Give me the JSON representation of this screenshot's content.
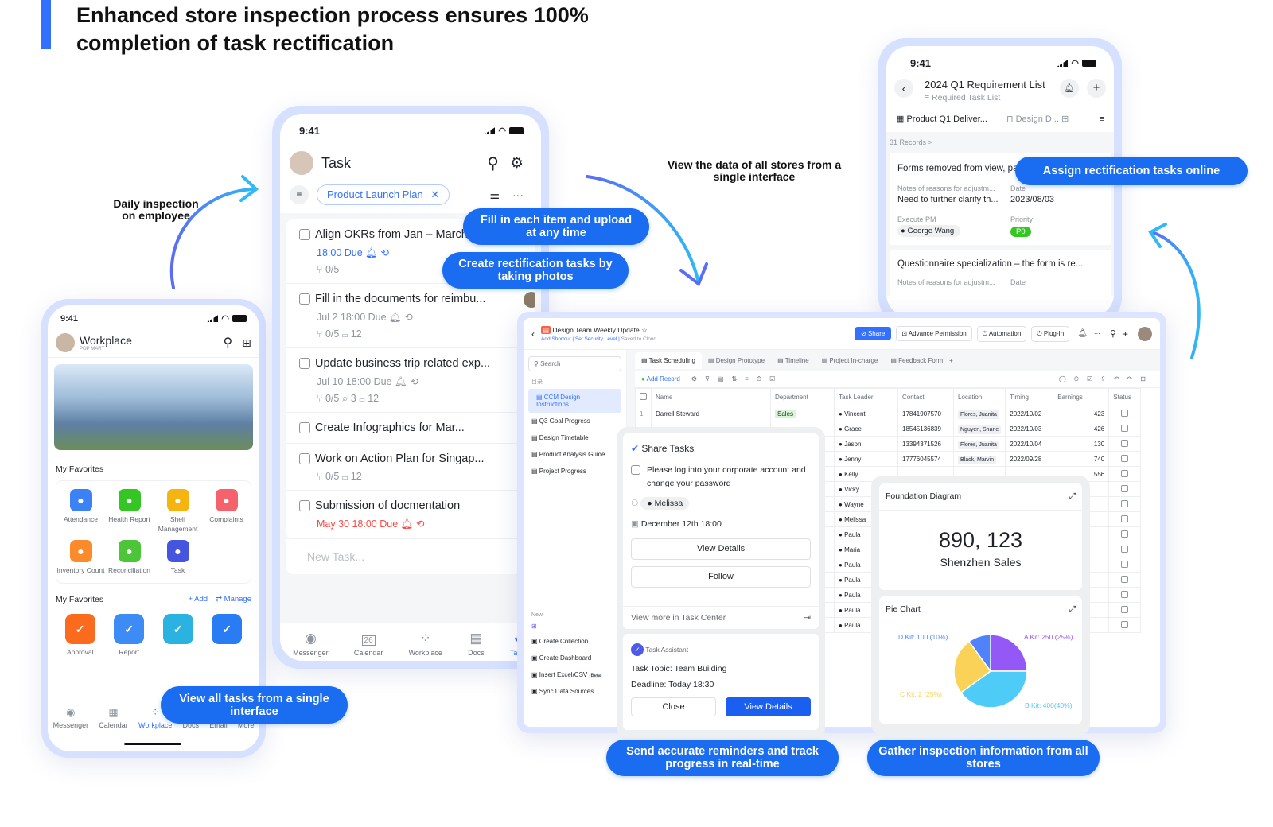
{
  "headline": {
    "line1": "Enhanced store inspection process ensures 100%",
    "line2": "completion of task rectification"
  },
  "notes": {
    "daily": "Daily inspection on employee",
    "view_data": "View the data of all stores from a single interface"
  },
  "callouts": {
    "fill": "Fill in each item and upload at any time",
    "create": "Create rectification tasks by taking photos",
    "assign": "Assign rectification tasks online",
    "view_all": "View all tasks from a single interface",
    "send": "Send accurate reminders and track progress in real-time",
    "gather": "Gather inspection information from all stores"
  },
  "colors": {
    "accent": "#1a6cf0",
    "frame": "#d6e0ff",
    "brand_blue": "#3370ff"
  },
  "workplace_phone": {
    "time": "9:41",
    "title": "Workplace",
    "subtitle": "POP MART",
    "favorites_title": "My Favorites",
    "favorites": [
      {
        "label": "Attendance",
        "icon": "location-pin-icon",
        "color": "#3b82f6"
      },
      {
        "label": "Health Report",
        "icon": "shield-plus-icon",
        "color": "#34c724"
      },
      {
        "label": "Shelf Management",
        "icon": "box-icon",
        "color": "#f5b40f"
      },
      {
        "label": "Complaints",
        "icon": "warning-icon",
        "color": "#f5626b"
      },
      {
        "label": "Inventory Count",
        "icon": "boxes-icon",
        "color": "#fb8a2b"
      },
      {
        "label": "Reconciliation",
        "icon": "yen-icon",
        "color": "#4cc538"
      },
      {
        "label": "Task",
        "icon": "check-icon",
        "color": "#4655e0"
      }
    ],
    "favorites2_title": "My Favorites",
    "add": "+ Add",
    "manage": "⇄ Manage",
    "apps2": [
      {
        "label": "Approval",
        "color": "#fb6b1e"
      },
      {
        "label": "Report",
        "color": "#3d8bf5"
      },
      {
        "label": "",
        "color": "#2ab3e0"
      },
      {
        "label": "",
        "color": "#2a7cf5"
      }
    ],
    "tabs": [
      "Messenger",
      "Calendar",
      "Workplace",
      "Docs",
      "Email",
      "More"
    ]
  },
  "task_phone": {
    "time": "9:41",
    "title": "Task",
    "filter": "Product Launch Plan",
    "tasks": [
      {
        "title": "Align OKRs from Jan – March, a...",
        "due": "18:00 Due",
        "extra": "⑂ 0/5",
        "due_color": "#3370ff"
      },
      {
        "title": "Fill in the documents for reimbu...",
        "due": "Jul 2 18:00 Due",
        "extra": "⑂ 0/5  ▭ 12",
        "due_color": "#8f959e"
      },
      {
        "title": "Update business trip related exp...",
        "due": "Jul 10 18:00 Due",
        "extra": "⑂ 0/5  ⌀ 3  ▭ 12",
        "due_color": "#8f959e"
      },
      {
        "title": "Create Infographics for Mar...",
        "due": "",
        "extra": "",
        "badge": "+5"
      },
      {
        "title": "Work on Action Plan for Singap...",
        "due": "",
        "extra": "⑂ 0/5  ▭ 12"
      },
      {
        "title": "Submission of docmentation",
        "due": "May 30 18:00 Due",
        "extra": "",
        "due_color": "#f54a45"
      }
    ],
    "new_task": "New Task...",
    "tabs": [
      "Messenger",
      "Calendar",
      "Workplace",
      "Docs",
      "Tasks"
    ],
    "calendar_day": "26"
  },
  "req_phone": {
    "time": "9:41",
    "title": "2024 Q1 Requirement List",
    "subtitle": "Required Task List",
    "tab1": "Product Q1 Deliver...",
    "tab2": "Design D...",
    "records": "31 Records >",
    "item1": {
      "title": "Forms removed from view, parallel to dash...",
      "notes_label": "Notes of reasons for adjustm...",
      "notes": "Need to further clarify th...",
      "date_label": "Date",
      "date": "2023/08/03",
      "pm_label": "Execute PM",
      "pm": "George Wang",
      "priority_label": "Priority",
      "priority": "P0"
    },
    "item2": {
      "title": "Questionnaire specialization – the form is re...",
      "notes_label": "Notes of reasons for adjustm...",
      "date_label": "Date"
    }
  },
  "desktop": {
    "doc_title": "Design Team Weekly Update",
    "add_shortcut": "Add Shortcut",
    "security": "Set Security Level",
    "saved": "Saved to Cloud",
    "share": "Share",
    "advance": "Advance Permission",
    "automation": "Automation",
    "plugin": "Plug-In",
    "search": "Search",
    "catalog": "目录",
    "sidebar": [
      "CCM Design Instructions",
      "Q3 Goal Progress",
      "Design Timetable",
      "Product Analysis Guide",
      "Project Progress"
    ],
    "new_label": "New",
    "new_items": [
      "Create Collection",
      "Create Dashboard",
      "Insert Excel/CSV",
      "Sync Data Sources"
    ],
    "beta": "Beta",
    "tabs": [
      "Task Scheduling",
      "Design Prototype",
      "Timeline",
      "Project In-charge",
      "Feedback Form"
    ],
    "add_record": "Add Record",
    "columns": [
      "Name",
      "Department",
      "Task Leader",
      "Contact",
      "Location",
      "Timing",
      "Earnings",
      "Status"
    ],
    "rows": [
      {
        "n": "1",
        "name": "Darrell Steward",
        "dept": "Sales",
        "leader": "Vincent",
        "contact": "17841907570",
        "loc": "Flores, Juanita",
        "timing": "2022/10/02",
        "earn": "423"
      },
      {
        "leader": "Grace",
        "contact": "18545136839",
        "loc": "Nguyen, Shane",
        "timing": "2022/10/03",
        "earn": "426"
      },
      {
        "leader": "Jason",
        "contact": "13394371526",
        "loc": "Flores, Juanita",
        "timing": "2022/10/04",
        "earn": "130"
      },
      {
        "leader": "Jenny",
        "contact": "17776045574",
        "loc": "Black, Marvin",
        "timing": "2022/09/28",
        "earn": "740"
      },
      {
        "leader": "Kelly",
        "earn": "556"
      },
      {
        "leader": "Vicky"
      },
      {
        "leader": "Wayne"
      },
      {
        "leader": "Melissa"
      },
      {
        "leader": "Paula"
      },
      {
        "leader": "Maria"
      },
      {
        "leader": "Paula"
      },
      {
        "leader": "Paula"
      },
      {
        "leader": "Paula"
      },
      {
        "leader": "Paula"
      },
      {
        "leader": "Paula"
      }
    ]
  },
  "share_popup": {
    "title": "Share Tasks",
    "task": "Please log into your corporate account and change your password",
    "assignee": "Melissa",
    "date": "December 12th 18:00",
    "view_details": "View Details",
    "follow": "Follow",
    "more": "View more in Task Center",
    "assistant": "Task Assistant",
    "topic": "Task Topic: Team Building",
    "deadline": "Deadline: Today 18:30",
    "close": "Close",
    "view_details2": "View Details"
  },
  "dashboard": {
    "foundation_title": "Foundation Diagram",
    "value": "890, 123",
    "value_label": "Shenzhen Sales",
    "pie_title": "Pie Chart"
  },
  "chart_data": {
    "type": "pie",
    "title": "Pie Chart",
    "slices": [
      {
        "label": "A Kit: 250 (25%)",
        "value": 25,
        "color": "#9358f5"
      },
      {
        "label": "B Kit: 400(40%)",
        "value": 40,
        "color": "#4ecbf7"
      },
      {
        "label": "C Kit: 2 (25%)",
        "value": 25,
        "color": "#fad257"
      },
      {
        "label": "D Kit: 100 (10%)",
        "value": 10,
        "color": "#4e83fd"
      }
    ]
  }
}
